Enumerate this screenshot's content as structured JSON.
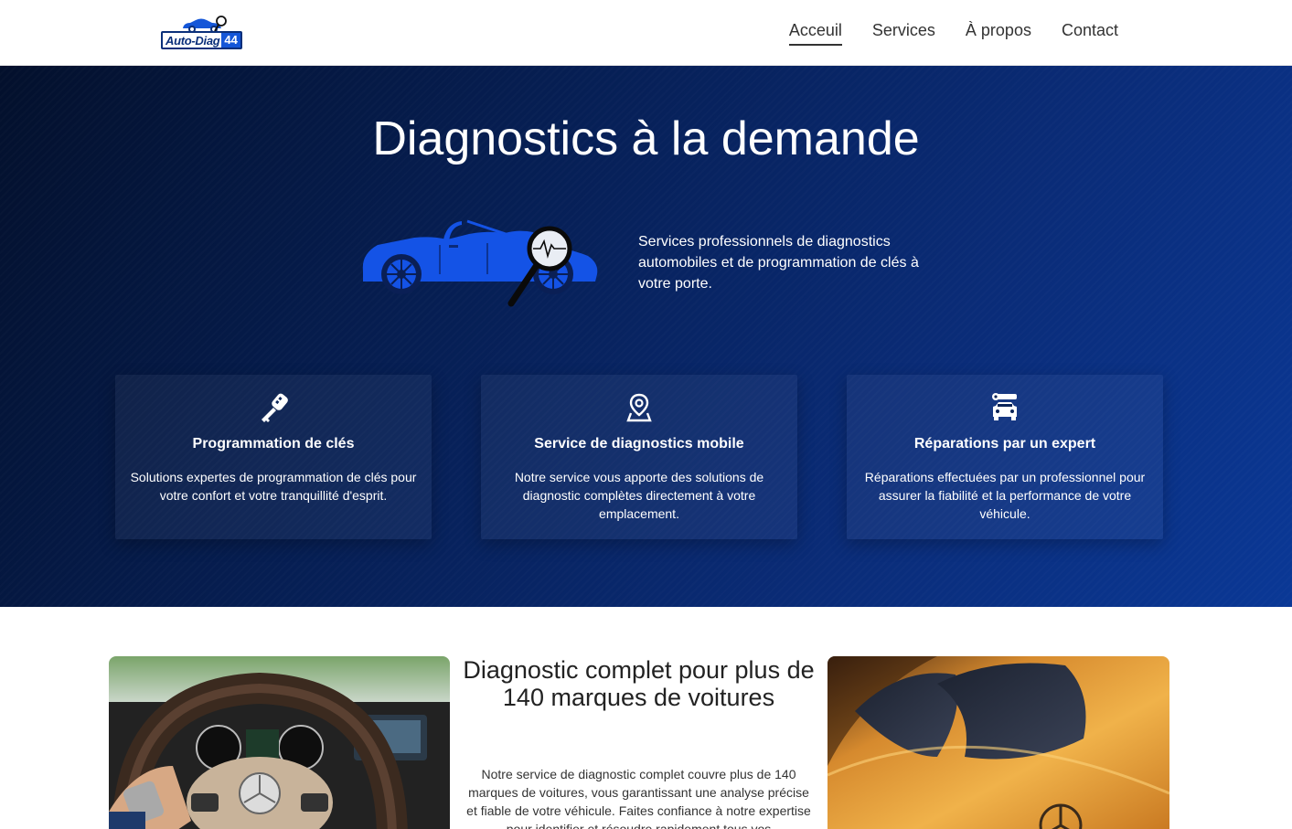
{
  "header": {
    "logo": {
      "text_a": "Auto-Diag",
      "text_b": "44",
      "icon": "car-magnifier-logo"
    },
    "nav": [
      {
        "label": "Acceuil",
        "active": true
      },
      {
        "label": "Services",
        "active": false
      },
      {
        "label": "À propos",
        "active": false
      },
      {
        "label": "Contact",
        "active": false
      }
    ]
  },
  "hero": {
    "title": "Diagnostics à la demande",
    "description": "Services professionnels de diagnostics automobiles et de programmation de clés à votre porte.",
    "illustration": "car-diagnostic-illustration",
    "colors": {
      "accent": "#1453e6",
      "bg_dark": "#03102c",
      "bg_light": "#0a3896"
    },
    "cards": [
      {
        "icon": "car-key-icon",
        "title": "Programmation de clés",
        "text": "Solutions expertes de programmation de clés pour votre confort et votre tranquillité d'esprit."
      },
      {
        "icon": "location-pin-icon",
        "title": "Service de diagnostics mobile",
        "text": "Notre service vous apporte des solutions de diagnostic complètes directement à votre emplacement."
      },
      {
        "icon": "car-repair-icon",
        "title": "Réparations par un expert",
        "text": "Réparations effectuées par un professionnel pour assurer la fiabilité et la performance de votre véhicule."
      }
    ]
  },
  "section": {
    "title": "Diagnostic complet pour plus de 140 marques de voitures",
    "text": "Notre service de diagnostic complet couvre plus de 140 marques de voitures, vous garantissant une analyse précise et fiable de votre véhicule. Faites confiance à notre expertise pour identifier et résoudre rapidement tous vos",
    "image_left": "steering-wheel-photo",
    "image_right": "orange-car-hood-photo"
  }
}
